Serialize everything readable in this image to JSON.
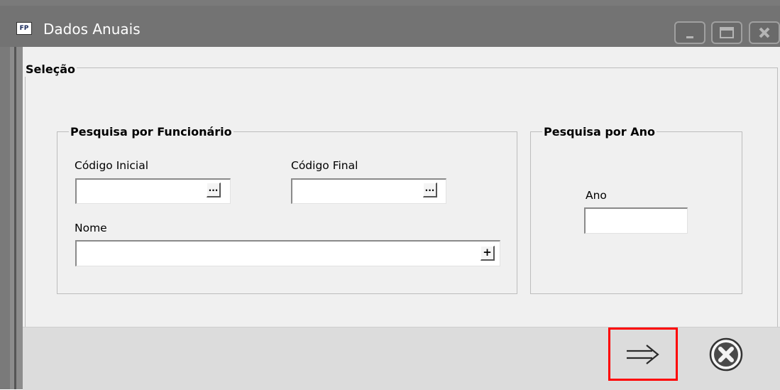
{
  "window": {
    "title": "Dados Anuais",
    "app_icon_text": "FP",
    "controls": [
      "minimize-icon",
      "maximize-icon",
      "close-icon"
    ]
  },
  "selection": {
    "title": "Seleção",
    "employee_search": {
      "title": "Pesquisa por Funcionário",
      "code_start_label": "Código Inicial",
      "code_start_value": "",
      "code_end_label": "Código Final",
      "code_end_value": "",
      "name_label": "Nome",
      "name_value": "",
      "lookup_button_text": "...",
      "add_button_text": "+"
    },
    "year_search": {
      "title": "Pesquisa por Ano",
      "year_label": "Ano",
      "year_value": ""
    }
  },
  "actions": {
    "next_icon": "arrow-right-icon",
    "cancel_icon": "cancel-circle-x-icon",
    "highlight_color": "#ff0000"
  }
}
